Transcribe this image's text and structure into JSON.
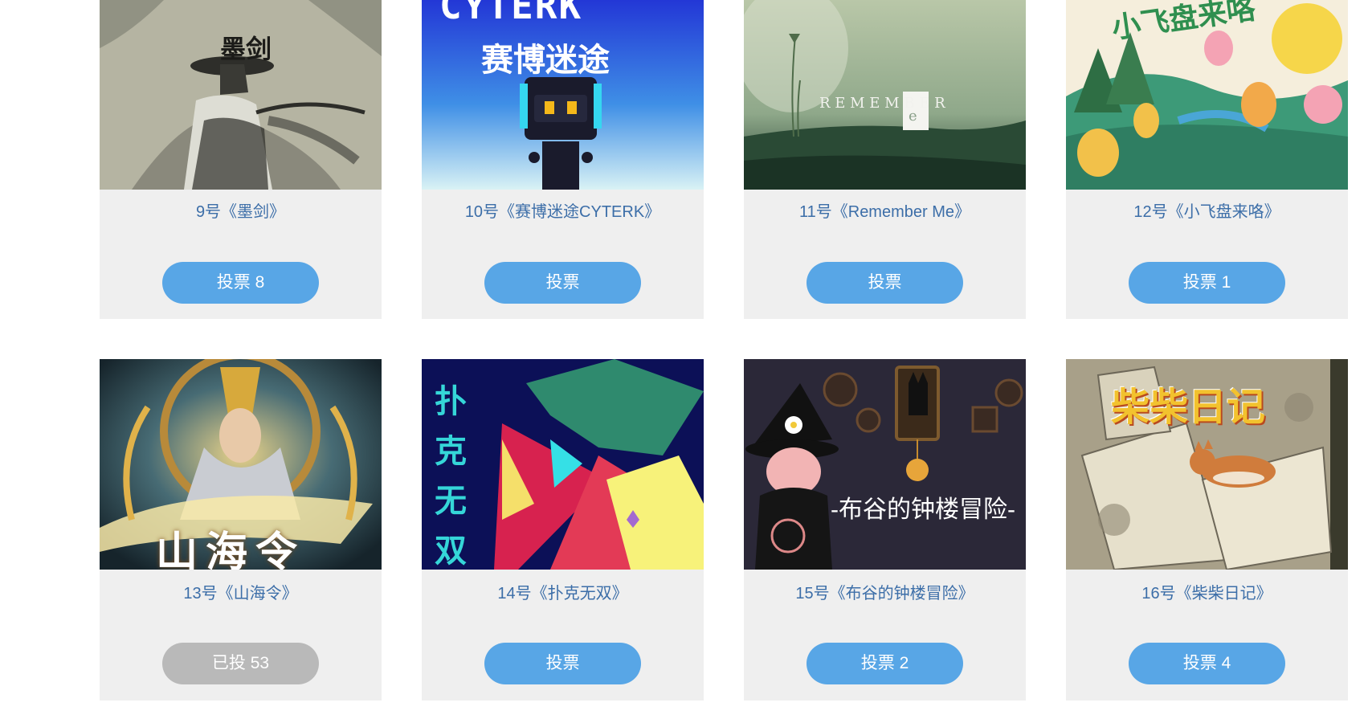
{
  "colors": {
    "card_bg": "#efefef",
    "title": "#3c6ea8",
    "vote_button": "#58a6e6",
    "voted_button": "#b9b9b9",
    "button_text": "#ffffff"
  },
  "entries": [
    {
      "title": "9号《墨剑》",
      "vote_label": "投票 8",
      "voted": false,
      "art_text": [
        "墨剑"
      ]
    },
    {
      "title": "10号《赛博迷途CYTERK》",
      "vote_label": "投票",
      "voted": false,
      "art_text": [
        "CYTERK",
        "赛博迷途"
      ]
    },
    {
      "title": "11号《Remember Me》",
      "vote_label": "投票",
      "voted": false,
      "art_text": [
        "R E M E M B E R",
        "e"
      ]
    },
    {
      "title": "12号《小飞盘来咯》",
      "vote_label": "投票 1",
      "voted": false,
      "art_text": [
        "小飞盘来咯"
      ]
    },
    {
      "title": "13号《山海令》",
      "vote_label": "已投 53",
      "voted": true,
      "art_text": [
        "山海令"
      ]
    },
    {
      "title": "14号《扑克无双》",
      "vote_label": "投票",
      "voted": false,
      "art_text": [
        "扑",
        "克",
        "无",
        "双"
      ]
    },
    {
      "title": "15号《布谷的钟楼冒险》",
      "vote_label": "投票 2",
      "voted": false,
      "art_text": [
        "-布谷的钟楼冒险-"
      ]
    },
    {
      "title": "16号《柴柴日记》",
      "vote_label": "投票 4",
      "voted": false,
      "art_text": [
        "柴柴日记"
      ]
    }
  ]
}
